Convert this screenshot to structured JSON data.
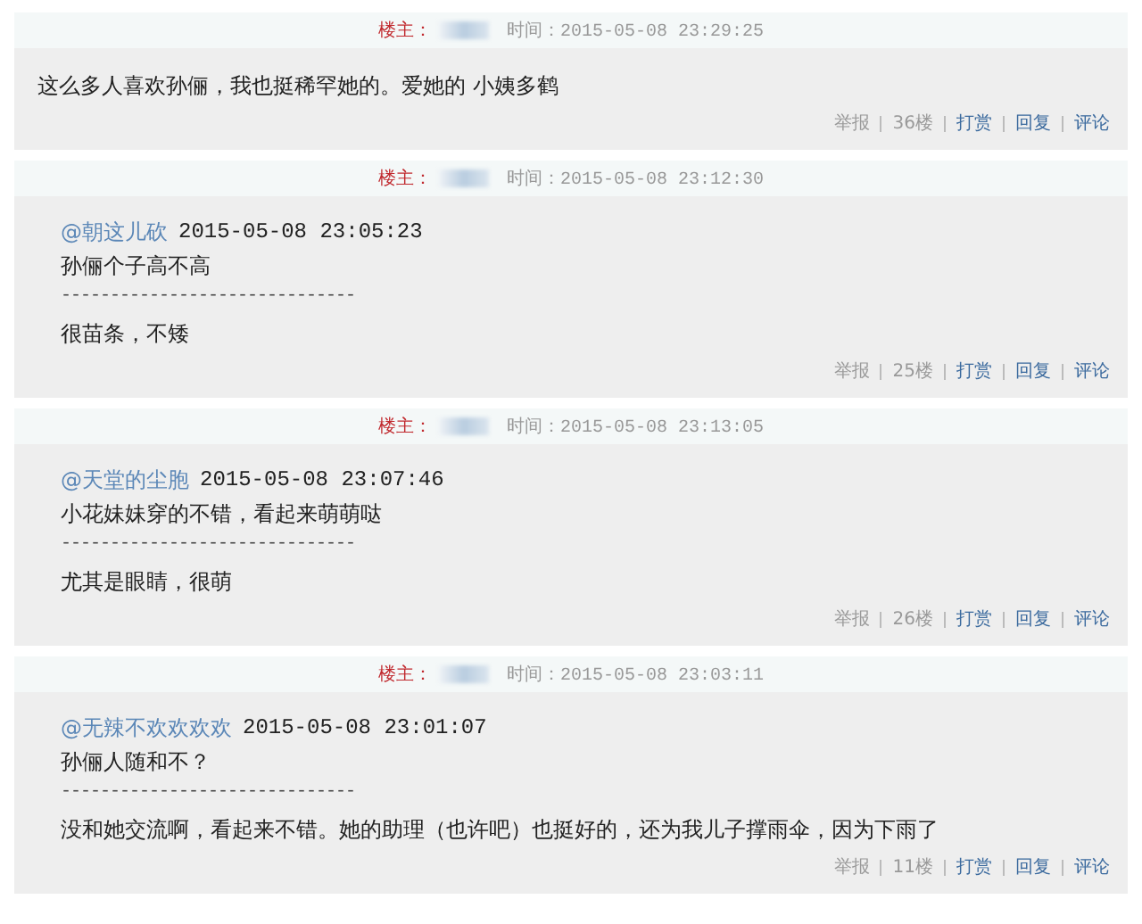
{
  "posts": [
    {
      "owner_label": "楼主：",
      "time": "时间：2015-05-08 23:29:25",
      "text": "这么多人喜欢孙俪，我也挺稀罕她的。爱她的 小姨多鹤",
      "actions": [
        {
          "label": "举报",
          "kind": "plain"
        },
        {
          "label": "36楼",
          "kind": "plain"
        },
        {
          "label": "打赏",
          "kind": "link"
        },
        {
          "label": "回复",
          "kind": "link"
        },
        {
          "label": "评论",
          "kind": "link"
        }
      ]
    },
    {
      "owner_label": "楼主：",
      "time": "时间：2015-05-08 23:12:30",
      "quote": {
        "user": "@朝这儿砍",
        "time": "2015-05-08 23:05:23",
        "text": "孙俪个子高不高",
        "divider": "------------------------------"
      },
      "text": "很苗条，不矮",
      "actions": [
        {
          "label": "举报",
          "kind": "plain"
        },
        {
          "label": "25楼",
          "kind": "plain"
        },
        {
          "label": "打赏",
          "kind": "link"
        },
        {
          "label": "回复",
          "kind": "link"
        },
        {
          "label": "评论",
          "kind": "link"
        }
      ]
    },
    {
      "owner_label": "楼主：",
      "time": "时间：2015-05-08 23:13:05",
      "quote": {
        "user": "@天堂的尘胞",
        "time": "2015-05-08 23:07:46",
        "text": "小花妹妹穿的不错，看起来萌萌哒",
        "divider": "------------------------------"
      },
      "text": "尤其是眼睛，很萌",
      "actions": [
        {
          "label": "举报",
          "kind": "plain"
        },
        {
          "label": "26楼",
          "kind": "plain"
        },
        {
          "label": "打赏",
          "kind": "link"
        },
        {
          "label": "回复",
          "kind": "link"
        },
        {
          "label": "评论",
          "kind": "link"
        }
      ]
    },
    {
      "owner_label": "楼主：",
      "time": "时间：2015-05-08 23:03:11",
      "quote": {
        "user": "@无辣不欢欢欢欢",
        "time": "2015-05-08 23:01:07",
        "text": "孙俪人随和不？",
        "divider": "------------------------------"
      },
      "text": "没和她交流啊，看起来不错。她的助理（也许吧）也挺好的，还为我儿子撑雨伞，因为下雨了",
      "actions": [
        {
          "label": "举报",
          "kind": "plain"
        },
        {
          "label": "11楼",
          "kind": "plain"
        },
        {
          "label": "打赏",
          "kind": "link"
        },
        {
          "label": "回复",
          "kind": "link"
        },
        {
          "label": "评论",
          "kind": "link"
        }
      ]
    }
  ]
}
